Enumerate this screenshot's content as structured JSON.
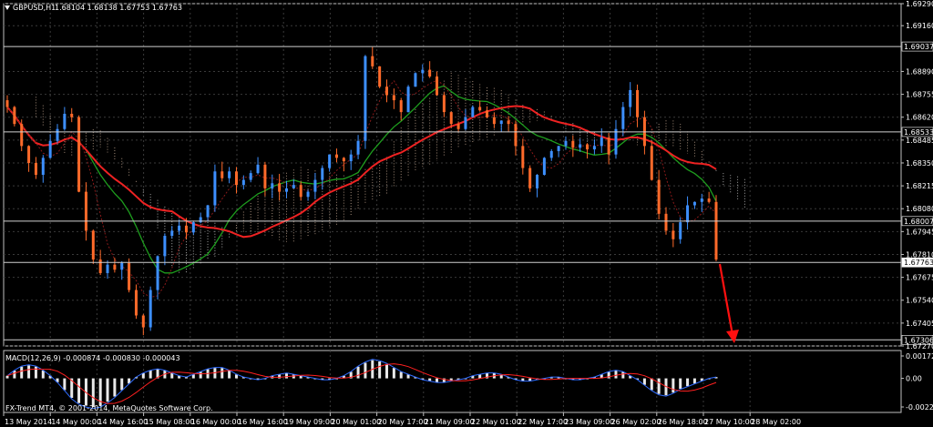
{
  "header": {
    "symbol_tf": "GBPUSD,H1",
    "ohlc": "1.68104 1.68138 1.67753 1.67763"
  },
  "macd": {
    "title": "MACD(12,26,9) -0.000874 -0.000830 -0.000043",
    "levels": [
      "0.001721",
      "0.00",
      "-0.002200"
    ],
    "values": [
      0.0002,
      0.0006,
      0.0009,
      0.001,
      0.0009,
      0.0006,
      0.0002,
      -0.0003,
      -0.0009,
      -0.0015,
      -0.0019,
      -0.0021,
      -0.0022,
      -0.0021,
      -0.0018,
      -0.0014,
      -0.0009,
      -0.0004,
      0.0001,
      0.0004,
      0.0006,
      0.0007,
      0.0006,
      0.0004,
      0.0002,
      0.0001,
      0.0003,
      0.0005,
      0.0007,
      0.0008,
      0.0008,
      0.0006,
      0.0003,
      0.0001,
      0,
      -0.0001,
      0,
      0.0002,
      0.0003,
      0.0004,
      0.0003,
      0.0002,
      0.0001,
      0,
      -0.0001,
      -0.0001,
      0,
      0.0002,
      0.0005,
      0.0009,
      0.0012,
      0.0014,
      0.0013,
      0.0011,
      0.0008,
      0.0005,
      0.0003,
      0.0001,
      -0.0001,
      -0.0002,
      -0.0003,
      -0.0003,
      -0.0002,
      -0.0001,
      0,
      0.0002,
      0.0003,
      0.0004,
      0.0004,
      0.0003,
      0.0001,
      -0.0001,
      -0.0002,
      -0.0002,
      -0.0001,
      0,
      0.0001,
      0.0001,
      0,
      -0.0001,
      -0.0001,
      0,
      0.0001,
      0.0003,
      0.0005,
      0.0006,
      0.0005,
      0.0002,
      -0.0001,
      -0.0005,
      -0.0009,
      -0.0012,
      -0.0013,
      -0.0011,
      -0.0008,
      -0.0006,
      -0.0004,
      -0.0002,
      0,
      0.0001
    ]
  },
  "footer": {
    "indicator_credit": "FX-Trend MT4, © 2001-2014, MetaQuotes Software Corp."
  },
  "chart_data": {
    "type": "candlestick",
    "symbol": "GBPUSD",
    "timeframe": "H1",
    "y_ticks": [
      "1.69290",
      "1.69160",
      "1.68890",
      "1.68755",
      "1.68620",
      "1.68485",
      "1.68350",
      "1.68215",
      "1.68080",
      "1.67945",
      "1.67810",
      "1.67675",
      "1.67540",
      "1.67405",
      "1.67270"
    ],
    "ylim": [
      1.6727,
      1.6929
    ],
    "horizontal_levels": [
      "1.69037",
      "1.68533",
      "1.68007",
      "1.67763",
      "1.67306"
    ],
    "current_price": "1.67763",
    "x_ticks": [
      "13 May 2014",
      "14 May 00:00",
      "14 May 16:00",
      "15 May 08:00",
      "16 May 00:00",
      "16 May 16:00",
      "19 May 09:00",
      "20 May 01:00",
      "20 May 17:00",
      "21 May 09:00",
      "22 May 01:00",
      "22 May 17:00",
      "23 May 09:00",
      "26 May 02:00",
      "26 May 18:00",
      "27 May 10:00",
      "28 May 02:00"
    ],
    "closes": [
      1.6868,
      1.6858,
      1.6845,
      1.6835,
      1.6828,
      1.6838,
      1.6848,
      1.6855,
      1.6864,
      1.6862,
      1.6818,
      1.6795,
      1.6778,
      1.677,
      1.6775,
      1.6772,
      1.6776,
      1.676,
      1.6745,
      1.6738,
      1.676,
      1.678,
      1.6792,
      1.6795,
      1.6798,
      1.6794,
      1.68,
      1.6803,
      1.681,
      1.683,
      1.6826,
      1.683,
      1.6822,
      1.6825,
      1.6829,
      1.6834,
      1.682,
      1.6823,
      1.6818,
      1.682,
      1.6822,
      1.6815,
      1.6818,
      1.6825,
      1.6832,
      1.684,
      1.6838,
      1.6836,
      1.684,
      1.6848,
      1.6898,
      1.6892,
      1.688,
      1.6875,
      1.6872,
      1.6865,
      1.688,
      1.6888,
      1.689,
      1.6886,
      1.6875,
      1.6865,
      1.6858,
      1.6855,
      1.6862,
      1.6868,
      1.6866,
      1.6862,
      1.6858,
      1.686,
      1.6858,
      1.6845,
      1.6832,
      1.682,
      1.6828,
      1.6838,
      1.6842,
      1.6845,
      1.6848,
      1.6844,
      1.6846,
      1.6843,
      1.6845,
      1.685,
      1.684,
      1.6855,
      1.6868,
      1.6878,
      1.6862,
      1.6845,
      1.6825,
      1.6805,
      1.6795,
      1.679,
      1.68,
      1.681,
      1.6812,
      1.6814,
      1.6812,
      1.6778
    ],
    "arrow_annotation": "down"
  }
}
